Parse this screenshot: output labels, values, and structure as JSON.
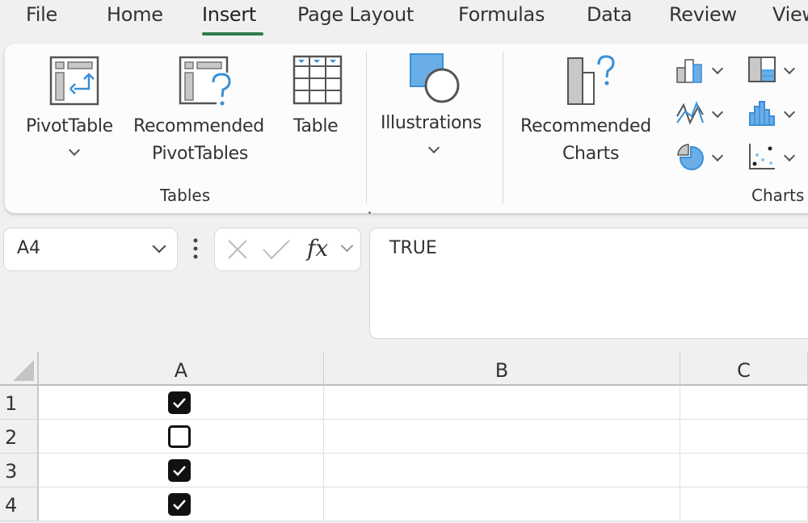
{
  "menu": {
    "tabs": [
      {
        "label": "File"
      },
      {
        "label": "Home"
      },
      {
        "label": "Insert",
        "active": true
      },
      {
        "label": "Page Layout"
      },
      {
        "label": "Formulas"
      },
      {
        "label": "Data"
      },
      {
        "label": "Review"
      },
      {
        "label": "View"
      }
    ],
    "active_color": "#2e7d4f"
  },
  "ribbon": {
    "tables_group": {
      "label": "Tables",
      "pivot_table": "PivotTable",
      "recommended_pivot_line1": "Recommended",
      "recommended_pivot_line2": "PivotTables",
      "table": "Table"
    },
    "illustrations_group": {
      "illustrations": "Illustrations"
    },
    "charts_group": {
      "label": "Charts",
      "recommended_charts_line1": "Recommended",
      "recommended_charts_line2": "Charts",
      "chart_icons": [
        "column-chart-icon",
        "hierarchy-chart-icon",
        "line-chart-icon",
        "statistic-chart-icon",
        "pie-chart-icon",
        "scatter-chart-icon"
      ]
    },
    "accent_color": "#4a9de0"
  },
  "formula_bar": {
    "name_box": "A4",
    "fx_label": "fx",
    "formula": "TRUE"
  },
  "sheet": {
    "columns": [
      "A",
      "B",
      "C"
    ],
    "rows": [
      {
        "number": "1",
        "A_checked": true
      },
      {
        "number": "2",
        "A_checked": false
      },
      {
        "number": "3",
        "A_checked": true
      },
      {
        "number": "4",
        "A_checked": true
      }
    ]
  }
}
